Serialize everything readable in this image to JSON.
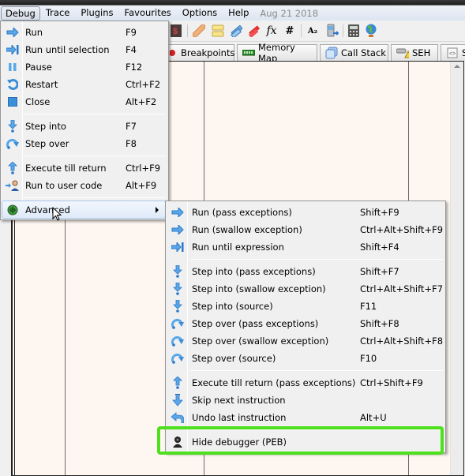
{
  "menubar": {
    "items": [
      "Debug",
      "Trace",
      "Plugins",
      "Favourites",
      "Options",
      "Help"
    ],
    "date": "Aug 21 2018"
  },
  "toolbar": {
    "icons": [
      "script-icon",
      "patch-icon",
      "comment-icon",
      "label-icon",
      "bookmark-icon",
      "function-icon",
      "hash-icon",
      "font-icon",
      "device-icon",
      "calculator-icon",
      "globe-icon"
    ],
    "fx_glyph": "fx",
    "hash_glyph": "#",
    "font_glyph": "A₂"
  },
  "tabs": [
    {
      "label": "Breakpoints",
      "icon": "breakpoint-icon"
    },
    {
      "label": "Memory Map",
      "icon": "memory-icon"
    },
    {
      "label": "Call Stack",
      "icon": "callstack-icon"
    },
    {
      "label": "SEH",
      "icon": "seh-icon"
    },
    {
      "label": "S",
      "icon": "script-icon"
    }
  ],
  "debug_menu": {
    "items": [
      {
        "label": "Run",
        "shortcut": "F9",
        "icon": "run-arrow-icon"
      },
      {
        "label": "Run until selection",
        "shortcut": "F4",
        "icon": "run-until-icon"
      },
      {
        "label": "Pause",
        "shortcut": "F12",
        "icon": "pause-icon"
      },
      {
        "label": "Restart",
        "shortcut": "Ctrl+F2",
        "icon": "restart-icon"
      },
      {
        "label": "Close",
        "shortcut": "Alt+F2",
        "icon": "stop-icon"
      },
      {
        "label": "Step into",
        "shortcut": "F7",
        "icon": "step-into-icon"
      },
      {
        "label": "Step over",
        "shortcut": "F8",
        "icon": "step-over-icon"
      },
      {
        "label": "Execute till return",
        "shortcut": "Ctrl+F9",
        "icon": "execute-return-icon"
      },
      {
        "label": "Run to user code",
        "shortcut": "Alt+F9",
        "icon": "user-code-icon"
      },
      {
        "label": "Advanced",
        "shortcut": "",
        "icon": "advanced-icon"
      }
    ]
  },
  "advanced_menu": {
    "items": [
      {
        "label": "Run (pass exceptions)",
        "shortcut": "Shift+F9",
        "icon": "run-arrow-icon"
      },
      {
        "label": "Run (swallow exception)",
        "shortcut": "Ctrl+Alt+Shift+F9",
        "icon": "run-arrow-icon"
      },
      {
        "label": "Run until expression",
        "shortcut": "Shift+F4",
        "icon": "run-until-icon"
      },
      {
        "label": "Step into (pass exceptions)",
        "shortcut": "Shift+F7",
        "icon": "step-into-icon"
      },
      {
        "label": "Step into (swallow exception)",
        "shortcut": "Ctrl+Alt+Shift+F7",
        "icon": "step-into-icon"
      },
      {
        "label": "Step into (source)",
        "shortcut": "F11",
        "icon": "step-into-icon"
      },
      {
        "label": "Step over (pass exceptions)",
        "shortcut": "Shift+F8",
        "icon": "step-over-icon"
      },
      {
        "label": "Step over (swallow exception)",
        "shortcut": "Ctrl+Alt+Shift+F8",
        "icon": "step-over-icon"
      },
      {
        "label": "Step over (source)",
        "shortcut": "F10",
        "icon": "step-over-icon"
      },
      {
        "label": "Execute till return (pass exceptions)",
        "shortcut": "Ctrl+Shift+F9",
        "icon": "execute-return-icon"
      },
      {
        "label": "Skip next instruction",
        "shortcut": "",
        "icon": "skip-icon"
      },
      {
        "label": "Undo last instruction",
        "shortcut": "Alt+U",
        "icon": "undo-icon"
      },
      {
        "label": "Hide debugger (PEB)",
        "shortcut": "",
        "icon": "hide-debugger-icon"
      }
    ]
  },
  "colors": {
    "highlight_box": "#4fe01d",
    "icon_blue": "#3a8fd8",
    "content_bg": "#fef7f1"
  }
}
